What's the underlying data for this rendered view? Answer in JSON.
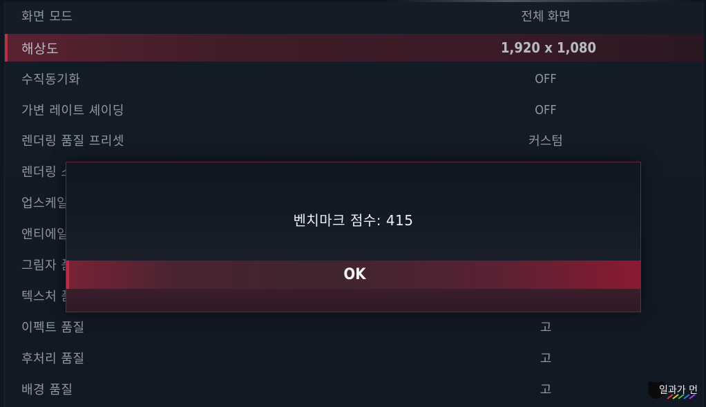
{
  "settings": [
    {
      "label": "화면 모드",
      "value": "전체 화면"
    },
    {
      "label": "해상도",
      "value": "1,920 x 1,080"
    },
    {
      "label": "수직동기화",
      "value": "OFF"
    },
    {
      "label": "가변 레이트 셰이딩",
      "value": "OFF"
    },
    {
      "label": "렌더링 품질 프리셋",
      "value": "커스텀"
    },
    {
      "label": "렌더링 스",
      "value": ""
    },
    {
      "label": "업스케일",
      "value": ""
    },
    {
      "label": "앤티에일",
      "value": ""
    },
    {
      "label": "그림자 품",
      "value": ""
    },
    {
      "label": "텍스처 품",
      "value": ""
    },
    {
      "label": "이펙트 품질",
      "value": "고"
    },
    {
      "label": "후처리 품질",
      "value": "고"
    },
    {
      "label": "배경 품질",
      "value": "고"
    }
  ],
  "dialog": {
    "message": "벤치마크 점수: 415",
    "ok_label": "OK"
  },
  "watermark": {
    "text": "일과가 먼"
  },
  "colors": {
    "accent": "#c22a48",
    "background": "#0f1620",
    "label": "#8e98a4"
  }
}
